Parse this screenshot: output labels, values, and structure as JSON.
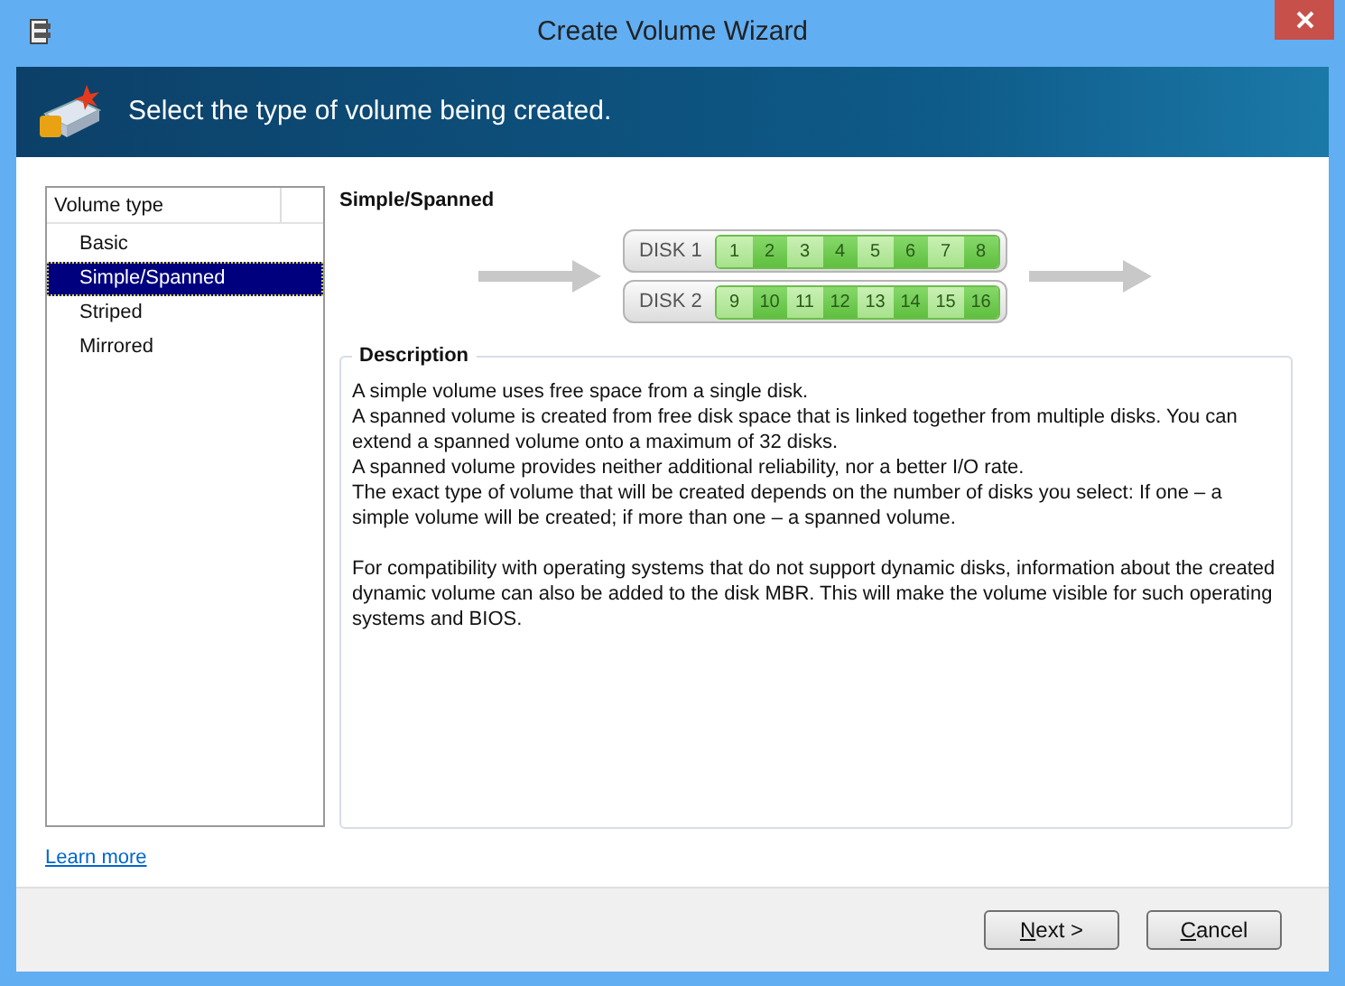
{
  "window": {
    "title": "Create Volume Wizard"
  },
  "header": {
    "title": "Select the type of volume being created."
  },
  "volume_list": {
    "column": "Volume type",
    "items": [
      {
        "label": "Basic",
        "selected": false
      },
      {
        "label": "Simple/Spanned",
        "selected": true
      },
      {
        "label": "Striped",
        "selected": false
      },
      {
        "label": "Mirrored",
        "selected": false
      }
    ]
  },
  "detail": {
    "title": "Simple/Spanned",
    "disks": [
      {
        "label": "DISK 1",
        "segments": [
          {
            "label": "1",
            "dark": false
          },
          {
            "label": "2",
            "dark": true
          },
          {
            "label": "3",
            "dark": false
          },
          {
            "label": "4",
            "dark": true
          },
          {
            "label": "5",
            "dark": false
          },
          {
            "label": "6",
            "dark": true
          },
          {
            "label": "7",
            "dark": false
          },
          {
            "label": "8",
            "dark": true
          }
        ]
      },
      {
        "label": "DISK 2",
        "segments": [
          {
            "label": "9",
            "dark": false
          },
          {
            "label": "10",
            "dark": true
          },
          {
            "label": "11",
            "dark": false
          },
          {
            "label": "12",
            "dark": true
          },
          {
            "label": "13",
            "dark": false
          },
          {
            "label": "14",
            "dark": true
          },
          {
            "label": "15",
            "dark": false
          },
          {
            "label": "16",
            "dark": true
          }
        ]
      }
    ],
    "description": {
      "title": "Description",
      "paragraphs": [
        [
          "A simple volume uses free space from a single disk.",
          "A spanned volume is created from free disk space that is linked together from multiple disks. You can extend a spanned volume onto a maximum of 32 disks.",
          "A spanned volume provides neither additional reliability, nor a better I/O rate.",
          "The exact type of volume that will be created depends on the number of disks you select: If one – a simple volume will be created; if more than one – a spanned volume."
        ],
        [
          "For compatibility with operating systems that do not support dynamic disks, information about the created dynamic volume can also be added to the disk MBR. This will make the volume visible for such operating systems and BIOS."
        ]
      ]
    }
  },
  "learn_more": "Learn more",
  "buttons": [
    {
      "label": "Next >",
      "first_letter_underlined": true
    },
    {
      "label": "Cancel",
      "first_letter_underlined": true
    }
  ]
}
